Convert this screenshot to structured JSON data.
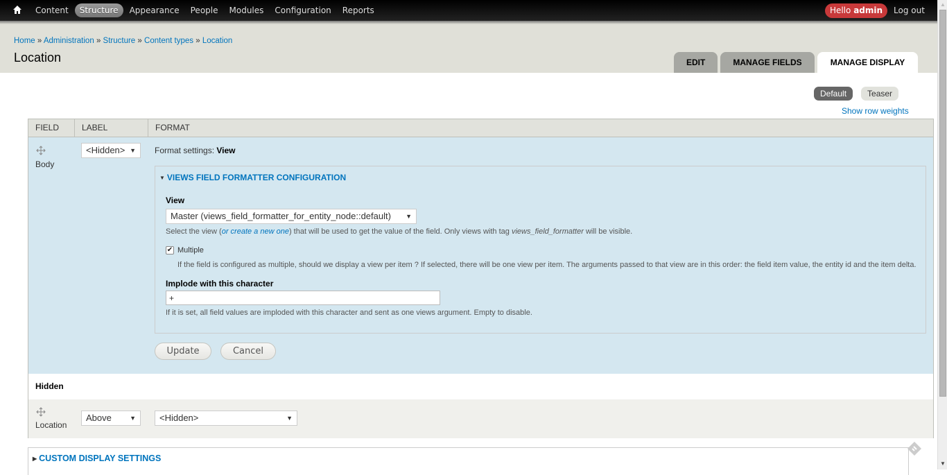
{
  "toolbar": {
    "home_icon": "home-icon",
    "menu": [
      {
        "label": "Content",
        "active": false
      },
      {
        "label": "Structure",
        "active": true
      },
      {
        "label": "Appearance",
        "active": false
      },
      {
        "label": "People",
        "active": false
      },
      {
        "label": "Modules",
        "active": false
      },
      {
        "label": "Configuration",
        "active": false
      },
      {
        "label": "Reports",
        "active": false
      }
    ],
    "hello_prefix": "Hello",
    "hello_user": "admin",
    "logout": "Log out",
    "accent_color": "#c8393a"
  },
  "breadcrumb": [
    {
      "label": "Home"
    },
    {
      "label": "Administration"
    },
    {
      "label": "Structure"
    },
    {
      "label": "Content types"
    },
    {
      "label": "Location"
    }
  ],
  "breadcrumb_separator": "»",
  "page_title": "Location",
  "tabs": [
    {
      "label": "EDIT",
      "active": false
    },
    {
      "label": "MANAGE FIELDS",
      "active": false
    },
    {
      "label": "MANAGE DISPLAY",
      "active": true
    }
  ],
  "secondary_tabs": [
    {
      "label": "Default",
      "active": true
    },
    {
      "label": "Teaser",
      "active": false
    }
  ],
  "show_row_weights": "Show row weights",
  "table": {
    "headers": [
      "FIELD",
      "LABEL",
      "FORMAT"
    ],
    "rows": [
      {
        "field": "Body",
        "label_select": "<Hidden>",
        "format_settings_prefix": "Format settings:",
        "format_settings_value": "View",
        "fieldset": {
          "legend": "VIEWS FIELD FORMATTER CONFIGURATION",
          "view_label": "View",
          "view_select": "Master (views_field_formatter_for_entity_node::default)",
          "view_desc_before": "Select the view (",
          "view_desc_link": "or create a new one",
          "view_desc_middle": ") that will be used to get the value of the field. Only views with tag ",
          "view_desc_tag": "views_field_formatter",
          "view_desc_after": " will be visible.",
          "multiple_label": "Multiple",
          "multiple_checked": true,
          "multiple_desc": "If the field is configured as multiple, should we display a view per item ? If selected, there will be one view per item. The arguments passed to that view are in this order: the field item value, the entity id and the item delta.",
          "implode_label": "Implode with this character",
          "implode_value": "+",
          "implode_desc": "If it is set, all field values are imploded with this character and sent as one views argument. Empty to disable."
        },
        "update_button": "Update",
        "cancel_button": "Cancel"
      }
    ],
    "region_hidden": "Hidden",
    "hidden_rows": [
      {
        "field": "Location",
        "label_select": "Above",
        "format_select": "<Hidden>"
      }
    ]
  },
  "custom_display_settings": "CUSTOM DISPLAY SETTINGS",
  "link_color": "#0074bd"
}
